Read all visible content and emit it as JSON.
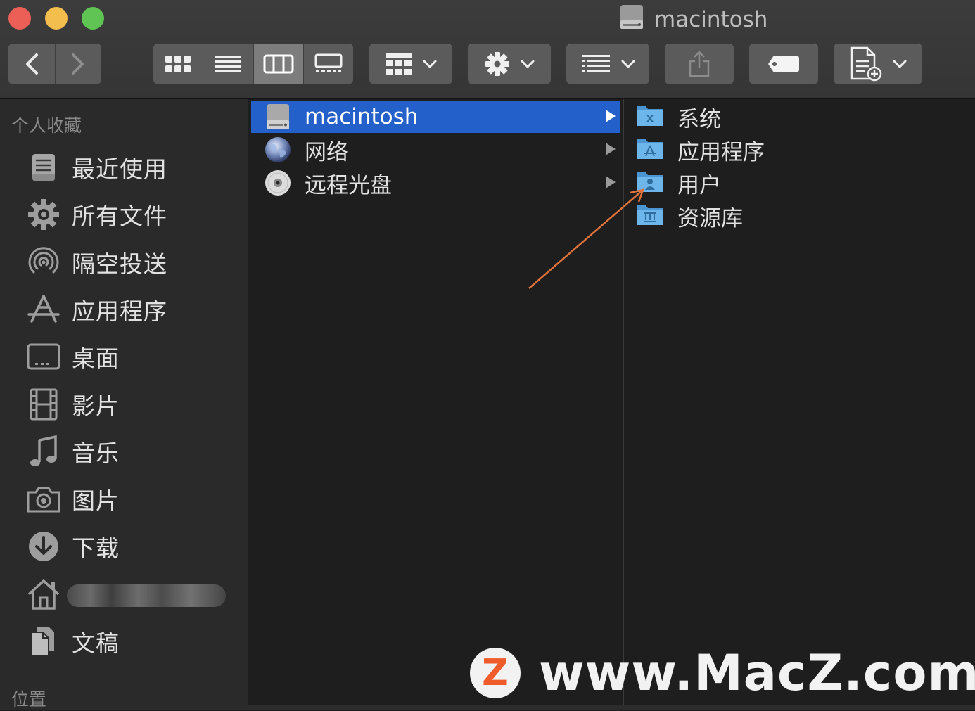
{
  "window": {
    "title": "macintosh"
  },
  "toolbar": {
    "icons": [
      "chevron-left-icon",
      "chevron-right-icon",
      "icon-view-icon",
      "list-view-icon",
      "column-view-icon",
      "gallery-view-icon",
      "group-icon",
      "gear-icon",
      "arrange-icon",
      "share-icon",
      "tag-icon",
      "new-document-icon"
    ],
    "active_view": "column"
  },
  "sidebar": {
    "favorites_header": "个人收藏",
    "items": [
      {
        "label": "最近使用",
        "icon": "recents-icon"
      },
      {
        "label": "所有文件",
        "icon": "gear-icon"
      },
      {
        "label": "隔空投送",
        "icon": "airdrop-icon"
      },
      {
        "label": "应用程序",
        "icon": "applications-icon"
      },
      {
        "label": "桌面",
        "icon": "desktop-icon"
      },
      {
        "label": "影片",
        "icon": "film-icon"
      },
      {
        "label": "音乐",
        "icon": "music-note-icon"
      },
      {
        "label": "图片",
        "icon": "camera-icon"
      },
      {
        "label": "下载",
        "icon": "download-icon"
      },
      {
        "label": "",
        "icon": "home-icon"
      },
      {
        "label": "文稿",
        "icon": "documents-icon"
      }
    ],
    "locations_header": "位置"
  },
  "column1": {
    "items": [
      {
        "label": "macintosh",
        "icon": "hard-drive-icon",
        "selected": true
      },
      {
        "label": "网络",
        "icon": "network-globe-icon",
        "selected": false
      },
      {
        "label": "远程光盘",
        "icon": "disc-icon",
        "selected": false
      }
    ]
  },
  "column2": {
    "items": [
      {
        "label": "系统",
        "icon": "system-folder-icon"
      },
      {
        "label": "应用程序",
        "icon": "applications-folder-icon"
      },
      {
        "label": "用户",
        "icon": "users-folder-icon"
      },
      {
        "label": "资源库",
        "icon": "library-folder-icon"
      }
    ]
  },
  "annotation": {
    "color": "#e0733a"
  },
  "watermark": {
    "logo_letter": "Z",
    "text": "www.MacZ.com"
  },
  "colors": {
    "selection": "#2460c9",
    "folder": "#5aa7e0",
    "window_bg": "#1e1e1e",
    "sidebar_bg": "#2a2a2a"
  }
}
